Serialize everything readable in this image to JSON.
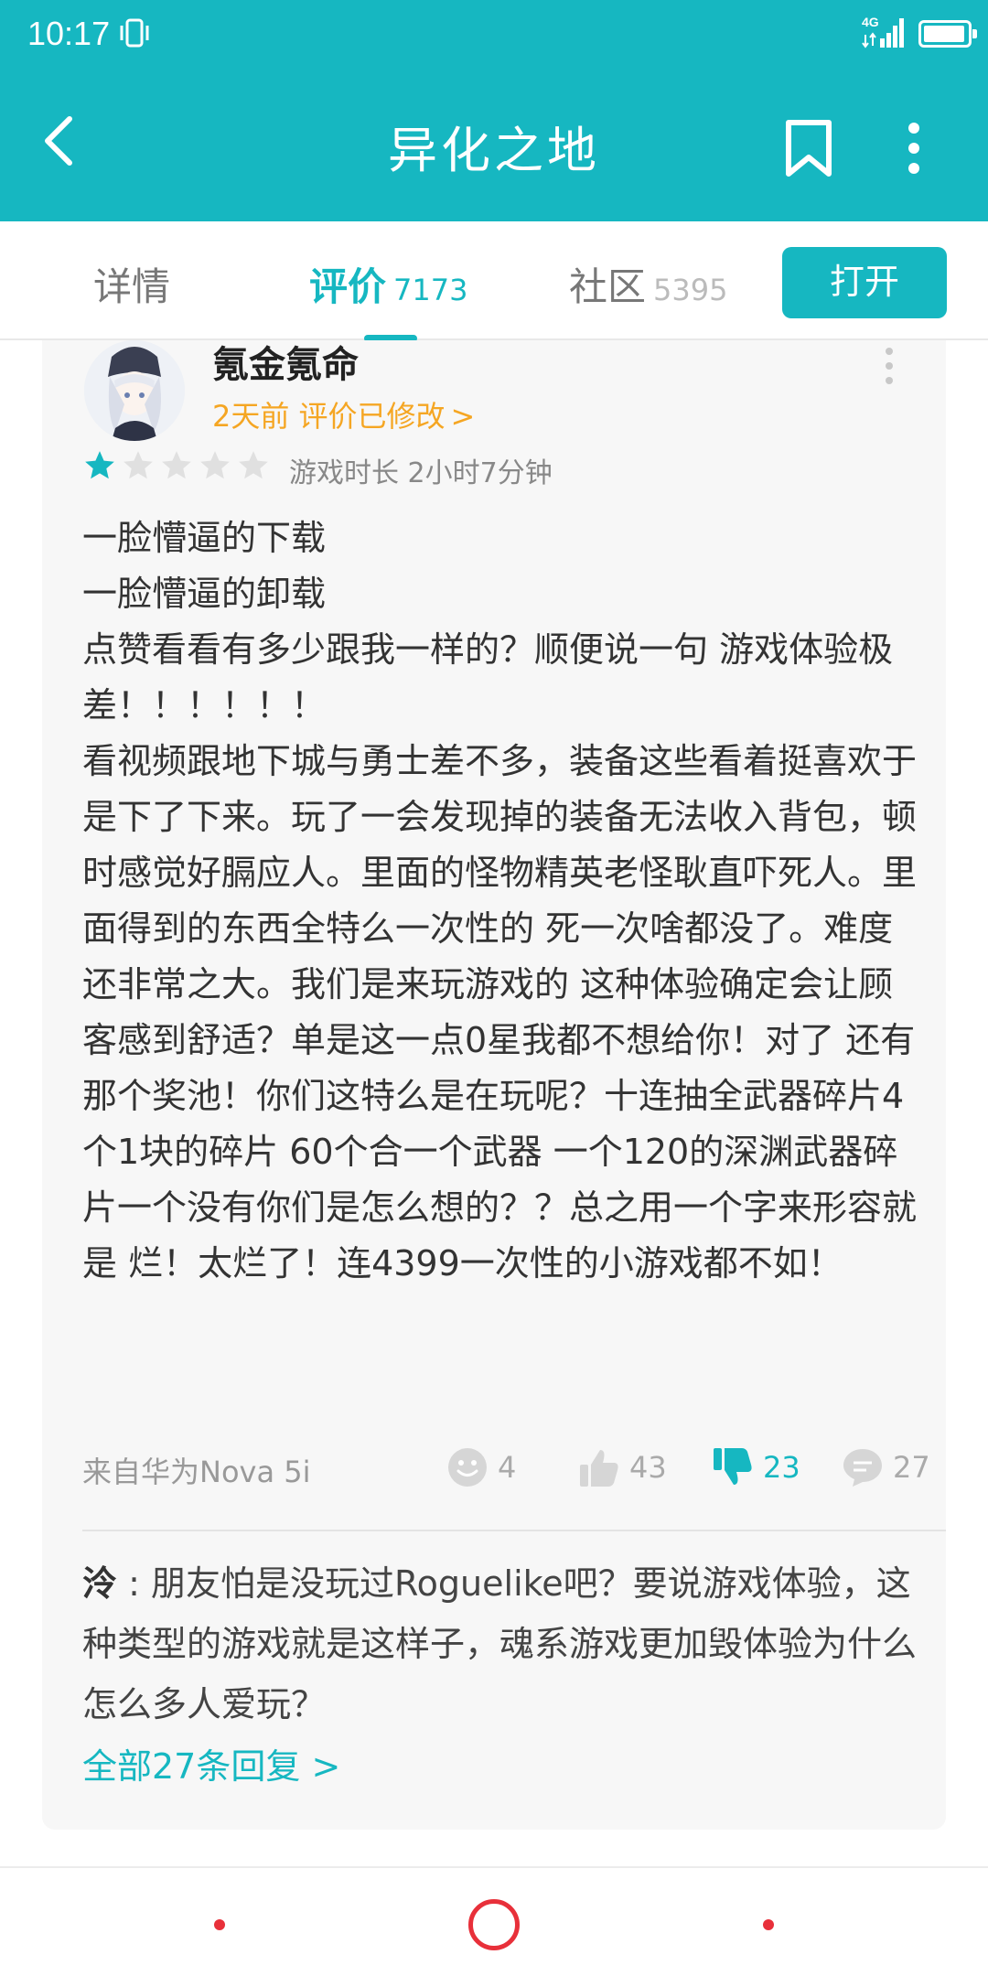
{
  "status_bar": {
    "time": "10:17",
    "network": "4G",
    "icons": [
      "vibrate-icon",
      "signal-icon",
      "battery-icon"
    ]
  },
  "header": {
    "title": "异化之地",
    "icons": [
      "back-icon",
      "bookmark-icon",
      "more-vertical-icon"
    ]
  },
  "tabs": [
    {
      "label": "详情",
      "count": ""
    },
    {
      "label": "评价",
      "count": "7173"
    },
    {
      "label": "社区",
      "count": "5395"
    }
  ],
  "open_button": "打开",
  "review": {
    "username": "氪金氪命",
    "meta": "2天前 评价已修改",
    "meta_chevron": ">",
    "rating": 1,
    "rating_max": 5,
    "playtime": "游戏时长 2小时7分钟",
    "body": "一脸懵逼的下载\n一脸懵逼的卸载\n点赞看看有多少跟我一样的？顺便说一句 游戏体验极差！！！！！！\n看视频跟地下城与勇士差不多，装备这些看着挺喜欢于是下了下来。玩了一会发现掉的装备无法收入背包，顿时感觉好膈应人。里面的怪物精英老怪耿直吓死人。里面得到的东西全特么一次性的 死一次啥都没了。难度还非常之大。我们是来玩游戏的 这种体验确定会让顾客感到舒适？单是这一点0星我都不想给你！对了 还有那个奖池！你们这特么是在玩呢？十连抽全武器碎片4个1块的碎片 60个合一个武器 一个120的深渊武器碎片一个没有你们是怎么想的？？总之用一个字来形容就是 烂！太烂了！连4399一次性的小游戏都不如！",
    "device": "来自华为Nova 5i",
    "stats": {
      "emoji": "4",
      "likes": "43",
      "dislikes": "23",
      "comments": "27"
    },
    "accent_color": "#16b7c1",
    "meta_color": "#f5a623"
  },
  "reply": {
    "name": "泠",
    "separator": " : ",
    "text": "朋友怕是没玩过Roguelike吧？要说游戏体验，这种类型的游戏就是这样子，魂系游戏更加毁体验为什么怎么多人爱玩？"
  },
  "all_replies": "全部27条回复",
  "all_replies_chevron": ">"
}
